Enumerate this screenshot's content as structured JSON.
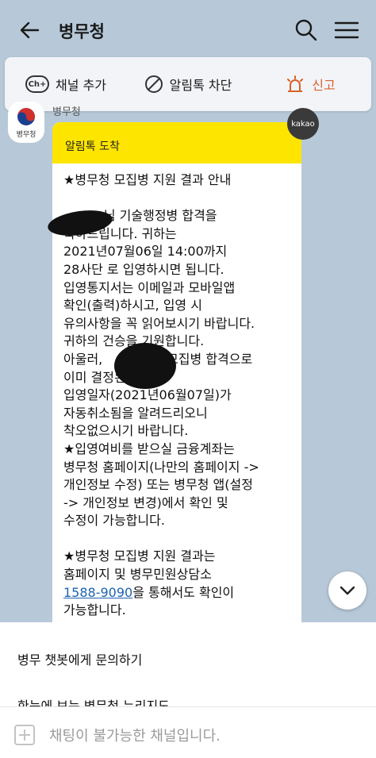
{
  "header": {
    "title": "병무청"
  },
  "action_bar": {
    "add_channel": "채널 추가",
    "ch_icon": "Ch+",
    "block_alimtalk": "알림톡 차단",
    "report": "신고"
  },
  "chat": {
    "sender_name": "병무청",
    "profile_label": "병무청",
    "kakao_badge": "kakao",
    "bubble_header": "알림톡 도착",
    "body_text": "★병무청 모집병 지원 결과 안내\n\n          님 기술행정병 합격을\n축하드립니다. 귀하는\n2021년07월06일 14:00까지\n28사단 로 입영하시면 됩니다.\n입영통지서는 이메일과 모바일앱\n확인(출력)하시고, 입영 시\n유의사항을 꼭 읽어보시기 바랍니다.\n귀하의 건승을 기원합니다.\n아울러,            은 모집병 합격으로\n이미 결정된 현역병\n입영일자(2021년06월07일)가\n자동취소됨을 알려드리오니\n착오없으시기 바랍니다.\n★입영여비를 받으실 금융계좌는\n병무청 홈페이지(나만의 홈페이지 ->\n개인정보 수정) 또는 병무청 앱(설정\n-> 개인정보 변경)에서 확인 및\n수정이 가능합니다.\n\n★병무청 모집병 지원 결과는\n홈페이지 및 병무민원상담소\n",
    "phone": "1588-9090",
    "body_after_phone": "을 통해서도 확인이\n가능합니다."
  },
  "bottom_menu": {
    "items": [
      "병무 챗봇에게 문의하기",
      "한눈에 보는 병무청 누리지도"
    ]
  },
  "input": {
    "placeholder": "채팅이 불가능한 채널입니다."
  },
  "icons": {
    "back": "back-arrow-icon",
    "search": "search-icon",
    "menu": "hamburger-menu-icon",
    "block": "block-icon",
    "report": "siren-icon",
    "scroll": "chevron-down-icon",
    "plus": "plus-icon",
    "logo": "government-emblem-icon"
  },
  "colors": {
    "background": "#b7c9d8",
    "bubble_header": "#fee500",
    "report": "#d9622b",
    "link": "#1e62b0"
  }
}
